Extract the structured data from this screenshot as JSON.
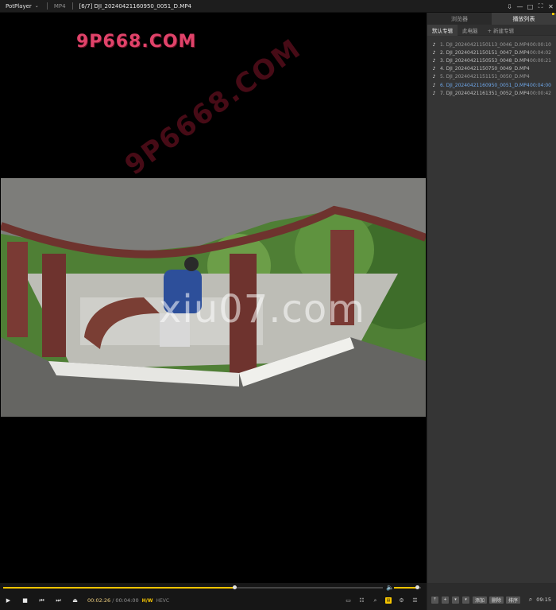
{
  "titlebar": {
    "app_name": "PotPlayer",
    "format": "MP4",
    "title": "[6/7] DJI_20240421160950_0051_D.MP4",
    "controls": [
      "pin-icon",
      "minimize-icon",
      "restore-icon",
      "fullscreen-icon",
      "close-icon"
    ]
  },
  "watermarks": {
    "top": "9P668.COM",
    "diagonal": "9P6668.COM",
    "center": "xiu07.com"
  },
  "playback": {
    "current_time": "00:02:26",
    "duration": "00:04:00",
    "progress": 0.608,
    "volume": 0.85,
    "hw_label": "H/W",
    "codec_label": "HEVC"
  },
  "panel": {
    "tabs": [
      "浏览器",
      "播放列表"
    ],
    "active_tab": 1,
    "subtabs": [
      "默认专辑",
      "此电脑",
      "+ 新建专辑"
    ],
    "items": [
      {
        "name": "1. DJI_20240421150113_0046_D.MP4",
        "duration": "00:00:10",
        "state": "dim"
      },
      {
        "name": "2. DJI_20240421150151_0047_D.MP4",
        "duration": "00:04:02",
        "state": "normal"
      },
      {
        "name": "3. DJI_20240421150553_0048_D.MP4",
        "duration": "00:00:21",
        "state": "normal"
      },
      {
        "name": "4. DJI_20240421150750_0049_D.MP4",
        "duration": "",
        "state": "normal"
      },
      {
        "name": "5. DJI_20240421151151_0050_D.MP4",
        "duration": "",
        "state": "dim"
      },
      {
        "name": "6. DJI_20240421160950_0051_D.MP4",
        "duration": "00:04:00",
        "state": "active"
      },
      {
        "name": "7. DJI_20240421161351_0052_D.MP4",
        "duration": "00:00:42",
        "state": "normal"
      }
    ],
    "bottom_buttons": [
      "添加",
      "删除",
      "排序"
    ],
    "clock": "09:15"
  }
}
